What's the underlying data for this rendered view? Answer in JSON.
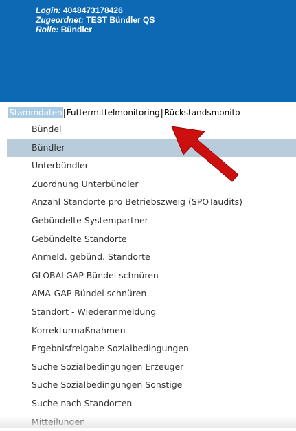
{
  "header": {
    "login_label": "Login:",
    "login_value": "4048473178426",
    "assigned_label": "Zugeordnet:",
    "assigned_value": "TEST Bündler QS",
    "role_label": "Rolle:",
    "role_value": "Bündler",
    "background_color": "#0e69b5"
  },
  "tabs": [
    {
      "label": "Stammdaten",
      "active": true
    },
    {
      "label": "Futtermittelmonitoring",
      "active": false
    },
    {
      "label": "Rückstandsmonito",
      "active": false
    }
  ],
  "tab_separator": "|",
  "menu": {
    "items": [
      {
        "label": "Bündel"
      },
      {
        "label": "Bündler",
        "selected": true
      },
      {
        "label": "Unterbündler"
      },
      {
        "label": "Zuordnung Unterbündler"
      },
      {
        "label": "Anzahl Standorte pro Betriebszweig (SPOTaudits)"
      },
      {
        "label": "Gebündelte Systempartner"
      },
      {
        "label": "Gebündelte Standorte"
      },
      {
        "label": "Anmeld. gebünd. Standorte"
      },
      {
        "label": "GLOBALGAP-Bündel schnüren"
      },
      {
        "label": "AMA-GAP-Bündel schnüren"
      },
      {
        "label": "Standort - Wiederanmeldung"
      },
      {
        "label": "Korrekturmaßnahmen"
      },
      {
        "label": "Ergebnisfreigabe Sozialbedingungen"
      },
      {
        "label": "Suche Sozialbedingungen Erzeuger"
      },
      {
        "label": "Suche Sozialbedingungen Sonstige"
      },
      {
        "label": "Suche nach Standorten"
      },
      {
        "label": "Mitteilungen"
      }
    ],
    "selected_color": "#b8ccdc"
  },
  "annotation": {
    "icon": "red-arrow-icon",
    "color": "#cc0000"
  }
}
